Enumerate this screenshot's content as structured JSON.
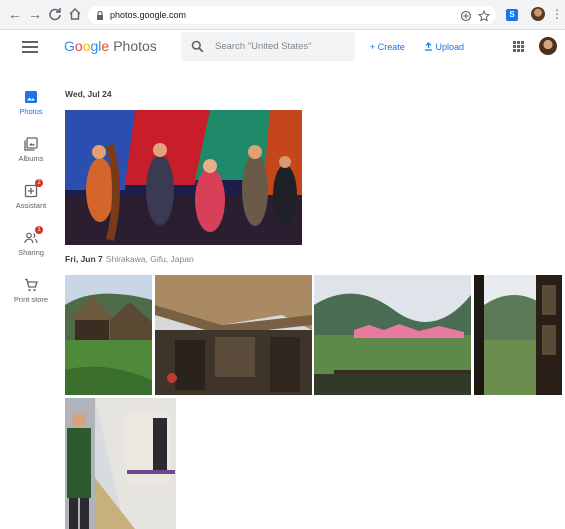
{
  "browser": {
    "url": "photos.google.com",
    "icons": [
      "back-arrow-icon",
      "forward-arrow-icon",
      "reload-icon",
      "home-icon",
      "lock-icon",
      "add-shortcut-icon",
      "bookmark-star-icon",
      "extension-icon",
      "profile-avatar",
      "more-menu-icon"
    ]
  },
  "header": {
    "logo": {
      "g1": "G",
      "g2": "o",
      "g3": "o",
      "g4": "g",
      "g5": "l",
      "g6": "e",
      "product": "Photos"
    },
    "search_placeholder": "Search \"United States\"",
    "create_label": "+ Create",
    "upload_label": "Upload"
  },
  "sidebar": {
    "items": [
      {
        "label": "Photos",
        "badge": ""
      },
      {
        "label": "Albums",
        "badge": ""
      },
      {
        "label": "Assistant",
        "badge": "2"
      },
      {
        "label": "Sharing",
        "badge": "1"
      },
      {
        "label": "Print store",
        "badge": ""
      }
    ]
  },
  "sections": [
    {
      "date": "Wed, Jul 24",
      "location": ""
    },
    {
      "date": "Fri, Jun 7",
      "location": "Shirakawa, Gifu, Japan"
    }
  ],
  "colors": {
    "accent": "#1a73e8",
    "badge": "#d93025",
    "sidebar_text": "#5f6368"
  }
}
